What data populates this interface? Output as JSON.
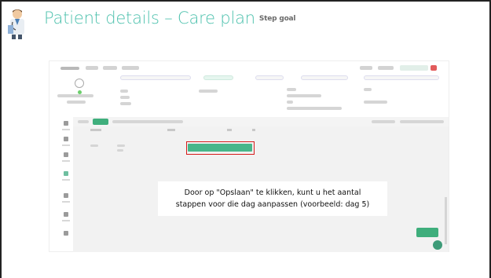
{
  "header": {
    "title": "Patient details – Care plan",
    "subtitle": "Step goal",
    "title_color": "#4fc2ae",
    "avatar_icon": "doctor-icon"
  },
  "screenshot": {
    "highlight_color": "#d51c1c",
    "accent_color": "#3fae7c",
    "icons": [
      "user-icon",
      "menu-icon",
      "help-icon"
    ]
  },
  "tooltip": {
    "line1": "Door op \"Opslaan\" te klikken, kunt u het aantal",
    "line2": "stappen voor die dag aanpassen (voorbeeld: dag 5)"
  }
}
